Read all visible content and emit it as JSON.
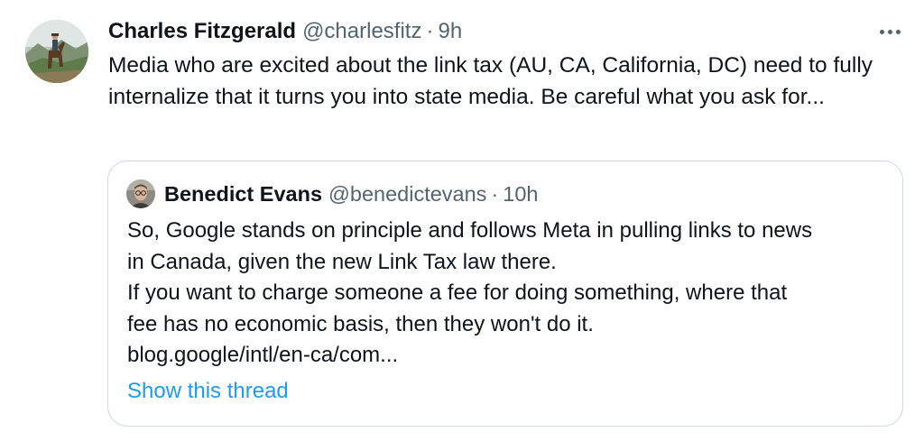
{
  "tweet": {
    "author": {
      "name": "Charles Fitzgerald",
      "handle": "@charlesfitz",
      "time": "9h",
      "avatar": "avatar-photo-rider-on-horse"
    },
    "separator": "·",
    "more_icon": "more-horizontal-icon",
    "text": "Media who are excited about the link tax (AU, CA, California, DC) need to fully internalize that it turns you into state media. Be careful what you ask for...",
    "quote": {
      "author": {
        "name": "Benedict Evans",
        "handle": "@benedictevans",
        "time": "10h",
        "avatar": "avatar-photo-man-glasses"
      },
      "lines": [
        "So, Google stands on principle and follows Meta in pulling links to news",
        "in Canada, given the new Link Tax law there.",
        "If you want to charge someone a fee for doing something, where that",
        "fee has no economic basis, then they won't do it.",
        "blog.google/intl/en-ca/com..."
      ],
      "show_thread_label": "Show this thread"
    }
  },
  "colors": {
    "text_primary": "#0f1419",
    "text_secondary": "#536471",
    "link": "#1d9bf0",
    "border": "#cfd9de"
  }
}
